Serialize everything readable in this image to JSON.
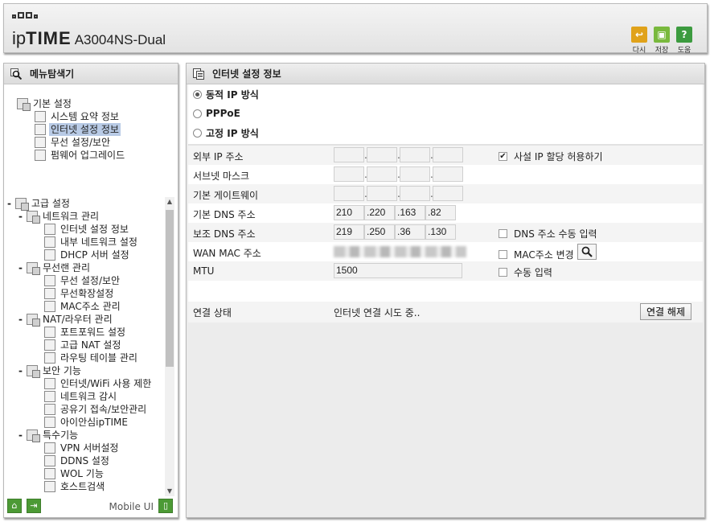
{
  "header": {
    "brand_prefix": "ip",
    "brand_bold": "TIME",
    "model": "A3004NS-Dual",
    "buttons": [
      {
        "label": "다시",
        "icon": "undo-icon",
        "color": "#e0a21a"
      },
      {
        "label": "저장",
        "icon": "save-icon",
        "color": "#79b93d"
      },
      {
        "label": "도움",
        "icon": "help-icon",
        "color": "#3c9b3f"
      }
    ]
  },
  "left": {
    "title": "메뉴탐색기",
    "basic_group": "기본 설정",
    "basic_items": [
      "시스템 요약 정보",
      "인터넷 설정 정보",
      "무선 설정/보안",
      "펌웨어 업그레이드"
    ],
    "advanced_group": "고급 설정",
    "advanced": [
      {
        "label": "네트워크 관리",
        "items": [
          "인터넷 설정 정보",
          "내부 네트워크 설정",
          "DHCP 서버 설정"
        ]
      },
      {
        "label": "무선랜 관리",
        "items": [
          "무선 설정/보안",
          "무선확장설정",
          "MAC주소 관리"
        ]
      },
      {
        "label": "NAT/라우터 관리",
        "items": [
          "포트포워드 설정",
          "고급 NAT 설정",
          "라우팅 테이블 관리"
        ]
      },
      {
        "label": "보안 기능",
        "items": [
          "인터넷/WiFi 사용 제한",
          "네트워크 감시",
          "공유기 접속/보안관리",
          "아이안심ipTIME"
        ]
      },
      {
        "label": "특수기능",
        "items": [
          "VPN 서버설정",
          "DDNS 설정",
          "WOL 기능",
          "호스트검색"
        ]
      }
    ],
    "mobile_label": "Mobile UI"
  },
  "right": {
    "title": "인터넷 설정 정보",
    "modes": [
      {
        "label": "동적 IP 방식",
        "selected": true
      },
      {
        "label": "PPPoE",
        "selected": false
      },
      {
        "label": "고정 IP 방식",
        "selected": false
      }
    ],
    "fields": {
      "ext_ip_label": "외부 IP 주소",
      "private_ip_label": "사설 IP 할당 허용하기",
      "private_ip_checked": true,
      "subnet_label": "서브넷 마스크",
      "gateway_label": "기본 게이트웨이",
      "dns1_label": "기본 DNS 주소",
      "dns1": [
        "210",
        ".220",
        ".163",
        ".82"
      ],
      "dns2_label": "보조 DNS 주소",
      "dns2": [
        "219",
        ".250",
        ".36",
        ".130"
      ],
      "dns_manual_label": "DNS 주소 수동 입력",
      "wan_mac_label": "WAN MAC 주소",
      "mac_change_label": "MAC주소 변경",
      "mtu_label": "MTU",
      "mtu": "1500",
      "manual_label": "수동 입력"
    },
    "connection": {
      "label": "연결 상태",
      "status": "인터넷 연결 시도 중..",
      "button": "연결 해제"
    }
  }
}
